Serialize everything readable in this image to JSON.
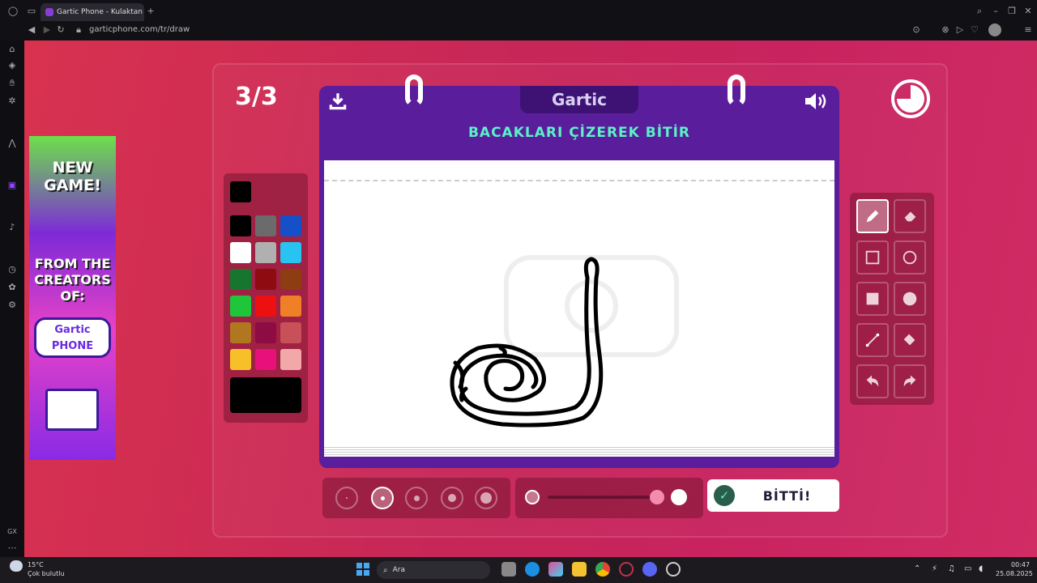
{
  "browser": {
    "tab_title": "Gartic Phone - Kulaktan K",
    "url": "garticphone.com/tr/draw"
  },
  "game": {
    "round": "3/3",
    "prompt": "BACAKLARI ÇİZEREK BİTİR",
    "logo": "Gartic",
    "done_label": "BİTTİ!",
    "selected_color": "#000000",
    "selected_tool": "pencil",
    "selected_size_index": 1,
    "opacity_percent": 100
  },
  "palette": {
    "colors": [
      "#000000",
      "#6b6b6b",
      "#1550c8",
      "#ffffff",
      "#b0b0b0",
      "#28c3f0",
      "#17762e",
      "#8e0b12",
      "#8c3d12",
      "#1fc63a",
      "#ee1010",
      "#f08028",
      "#b07620",
      "#8e0b44",
      "#c85058",
      "#f8c028",
      "#e8107a",
      "#f2a8a8"
    ]
  },
  "ad": {
    "line1": "NEW",
    "line2": "GAME!",
    "line3": "FROM THE",
    "line4": "CREATORS",
    "line5": "OF:",
    "logo_top": "Gartic",
    "logo_bottom": "PHONE"
  },
  "taskbar": {
    "temperature": "15°C",
    "weather": "Çok bulutlu",
    "search": "Ara",
    "time": "00:47",
    "date": "25.08.2025"
  },
  "icons": {
    "download": "download-icon",
    "sound": "speaker-icon",
    "timer": "timer-icon"
  }
}
